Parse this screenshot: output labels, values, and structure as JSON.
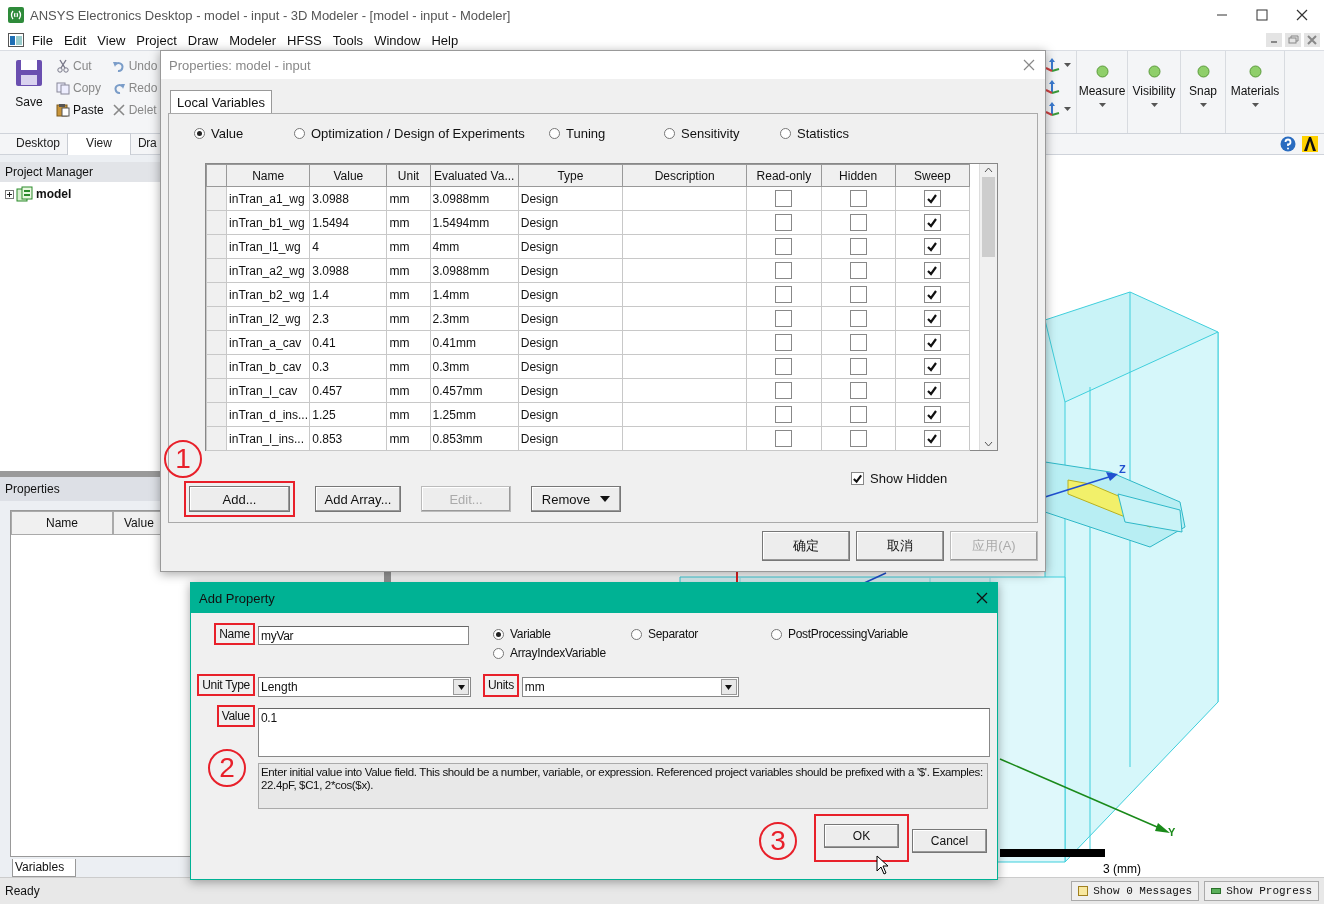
{
  "window": {
    "title": "ANSYS Electronics Desktop - model - input - 3D Modeler - [model - input - Modeler]"
  },
  "menu": [
    "File",
    "Edit",
    "View",
    "Project",
    "Draw",
    "Modeler",
    "HFSS",
    "Tools",
    "Window",
    "Help"
  ],
  "ribbon": {
    "save": "Save",
    "edit_columns": [
      [
        {
          "label": "Cut",
          "kind": "cut",
          "disabled": true
        },
        {
          "label": "Copy",
          "kind": "copy",
          "disabled": true
        },
        {
          "label": "Paste",
          "kind": "paste",
          "disabled": false
        }
      ],
      [
        {
          "label": "Undo",
          "kind": "undo",
          "disabled": true
        },
        {
          "label": "Redo",
          "kind": "redo",
          "disabled": true
        },
        {
          "label": "Delet",
          "kind": "delete",
          "disabled": true
        }
      ]
    ],
    "groups": [
      "Measure",
      "Visibility",
      "Snap",
      "Materials"
    ]
  },
  "ribbon_tabs": [
    {
      "label": "Desktop",
      "selected": false
    },
    {
      "label": "View",
      "selected": true
    },
    {
      "label": "Dra",
      "selected": false
    }
  ],
  "project_manager": {
    "title": "Project Manager",
    "tree": [
      {
        "label": "model",
        "expanded": false
      }
    ]
  },
  "properties_panel": {
    "title": "Properties",
    "columns": [
      "Name",
      "Value"
    ],
    "tabs": [
      {
        "label": "Variables",
        "selected": true
      }
    ]
  },
  "viewport": {
    "axis_labels": [
      {
        "label": "Z",
        "kind": "z"
      },
      {
        "label": "Y",
        "kind": "y"
      }
    ],
    "scale_label": "3 (mm)"
  },
  "status_bar": {
    "text": "Ready",
    "buttons": [
      "Show 0 Messages",
      "Show Progress"
    ]
  },
  "properties_dialog": {
    "title": "Properties: model - input",
    "tabs": [
      {
        "label": "Local Variables",
        "selected": true
      }
    ],
    "modes": [
      {
        "label": "Value",
        "selected": true
      },
      {
        "label": "Optimization / Design of Experiments",
        "selected": false
      },
      {
        "label": "Tuning",
        "selected": false
      },
      {
        "label": "Sensitivity",
        "selected": false
      },
      {
        "label": "Statistics",
        "selected": false
      }
    ],
    "columns": [
      "Name",
      "Value",
      "Unit",
      "Evaluated Va...",
      "Type",
      "Description",
      "Read-only",
      "Hidden",
      "Sweep"
    ],
    "rows": [
      {
        "name": "inTran_a1_wg",
        "value": "3.0988",
        "unit": "mm",
        "evaluated": "3.0988mm",
        "type": "Design",
        "read_only": false,
        "hidden": false,
        "sweep": true
      },
      {
        "name": "inTran_b1_wg",
        "value": "1.5494",
        "unit": "mm",
        "evaluated": "1.5494mm",
        "type": "Design",
        "read_only": false,
        "hidden": false,
        "sweep": true
      },
      {
        "name": "inTran_l1_wg",
        "value": "4",
        "unit": "mm",
        "evaluated": "4mm",
        "type": "Design",
        "read_only": false,
        "hidden": false,
        "sweep": true
      },
      {
        "name": "inTran_a2_wg",
        "value": "3.0988",
        "unit": "mm",
        "evaluated": "3.0988mm",
        "type": "Design",
        "read_only": false,
        "hidden": false,
        "sweep": true
      },
      {
        "name": "inTran_b2_wg",
        "value": "1.4",
        "unit": "mm",
        "evaluated": "1.4mm",
        "type": "Design",
        "read_only": false,
        "hidden": false,
        "sweep": true
      },
      {
        "name": "inTran_l2_wg",
        "value": "2.3",
        "unit": "mm",
        "evaluated": "2.3mm",
        "type": "Design",
        "read_only": false,
        "hidden": false,
        "sweep": true
      },
      {
        "name": "inTran_a_cav",
        "value": "0.41",
        "unit": "mm",
        "evaluated": "0.41mm",
        "type": "Design",
        "read_only": false,
        "hidden": false,
        "sweep": true
      },
      {
        "name": "inTran_b_cav",
        "value": "0.3",
        "unit": "mm",
        "evaluated": "0.3mm",
        "type": "Design",
        "read_only": false,
        "hidden": false,
        "sweep": true
      },
      {
        "name": "inTran_l_cav",
        "value": "0.457",
        "unit": "mm",
        "evaluated": "0.457mm",
        "type": "Design",
        "read_only": false,
        "hidden": false,
        "sweep": true
      },
      {
        "name": "inTran_d_ins...",
        "value": "1.25",
        "unit": "mm",
        "evaluated": "1.25mm",
        "type": "Design",
        "read_only": false,
        "hidden": false,
        "sweep": true
      },
      {
        "name": "inTran_l_ins...",
        "value": "0.853",
        "unit": "mm",
        "evaluated": "0.853mm",
        "type": "Design",
        "read_only": false,
        "hidden": false,
        "sweep": true
      }
    ],
    "show_hidden": {
      "label": "Show Hidden",
      "checked": true
    },
    "step": "1",
    "buttons": [
      {
        "label": "Add...",
        "kind": "plain",
        "disabled": false,
        "highlighted": true
      },
      {
        "label": "Add Array...",
        "kind": "plain",
        "disabled": false,
        "highlighted": false
      },
      {
        "label": "Edit...",
        "kind": "plain",
        "disabled": true,
        "highlighted": false
      },
      {
        "label": "Remove",
        "kind": "menu",
        "disabled": false,
        "highlighted": false
      }
    ],
    "footer_buttons": [
      {
        "label": "确定",
        "disabled": false
      },
      {
        "label": "取消",
        "disabled": false
      },
      {
        "label": "应用(A)",
        "disabled": true
      }
    ]
  },
  "add_property_dialog": {
    "title": "Add Property",
    "name": {
      "label": "Name",
      "value": "myVar",
      "highlighted": true
    },
    "kinds": [
      {
        "label": "Variable",
        "selected": true
      },
      {
        "label": "Separator",
        "selected": false
      },
      {
        "label": "PostProcessingVariable",
        "selected": false
      },
      {
        "label": "ArrayIndexVariable",
        "selected": false
      }
    ],
    "unit_type": {
      "label": "Unit Type",
      "value": "Length",
      "highlighted": true
    },
    "units": {
      "label": "Units",
      "value": "mm",
      "highlighted": true
    },
    "value": {
      "label": "Value",
      "value": "0.1",
      "highlighted": true
    },
    "help": "Enter initial value into Value field. This should be a number, variable, or expression. Referenced project variables should be prefixed with a '$'. Examples: 22.4pF, $C1, 2*cos($x).",
    "steps": [
      "2",
      "3"
    ],
    "buttons": [
      {
        "label": "OK",
        "highlighted": true
      },
      {
        "label": "Cancel",
        "highlighted": false
      }
    ]
  }
}
